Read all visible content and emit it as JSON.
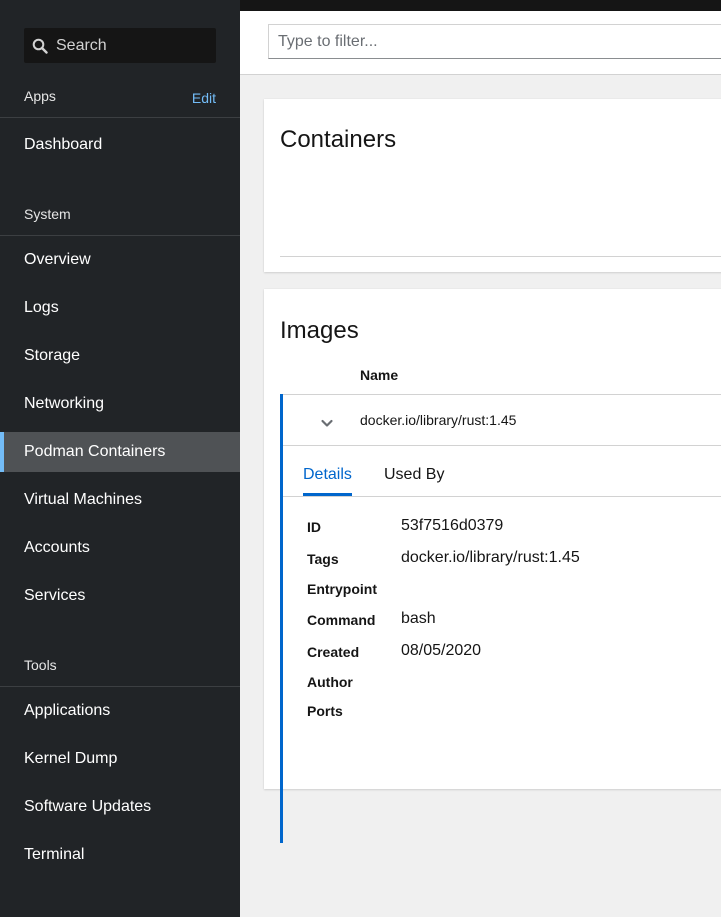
{
  "sidebar": {
    "search_label": "Search",
    "apps_section": {
      "title": "Apps",
      "edit_label": "Edit"
    },
    "apps_items": [
      {
        "label": "Dashboard"
      }
    ],
    "system_section": {
      "title": "System"
    },
    "system_items": [
      {
        "label": "Overview"
      },
      {
        "label": "Logs"
      },
      {
        "label": "Storage"
      },
      {
        "label": "Networking"
      },
      {
        "label": "Podman Containers",
        "active": true
      },
      {
        "label": "Virtual Machines"
      },
      {
        "label": "Accounts"
      },
      {
        "label": "Services"
      }
    ],
    "tools_section": {
      "title": "Tools"
    },
    "tools_items": [
      {
        "label": "Applications"
      },
      {
        "label": "Kernel Dump"
      },
      {
        "label": "Software Updates"
      },
      {
        "label": "Terminal"
      }
    ]
  },
  "filter": {
    "placeholder": "Type to filter..."
  },
  "containers_card": {
    "title": "Containers"
  },
  "images_card": {
    "title": "Images",
    "column_name": "Name",
    "row": {
      "name": "docker.io/library/rust:1.45",
      "expanded": true,
      "tabs": [
        {
          "label": "Details",
          "active": true
        },
        {
          "label": "Used By"
        }
      ],
      "details": {
        "id_label": "ID",
        "id": "53f7516d0379",
        "tags_label": "Tags",
        "tags": "docker.io/library/rust:1.45",
        "entrypoint_label": "Entrypoint",
        "entrypoint": "",
        "command_label": "Command",
        "command": "bash",
        "created_label": "Created",
        "created": "08/05/2020",
        "author_label": "Author",
        "author": "",
        "ports_label": "Ports",
        "ports": ""
      }
    }
  },
  "colors": {
    "sidebar_bg": "#212427",
    "active_item_bg": "#4f5255",
    "accent_blue": "#0066cc",
    "link_blue": "#73bcf7"
  },
  "icons": {
    "search": "search-icon",
    "expand_toggle": "chevron-down-icon"
  }
}
